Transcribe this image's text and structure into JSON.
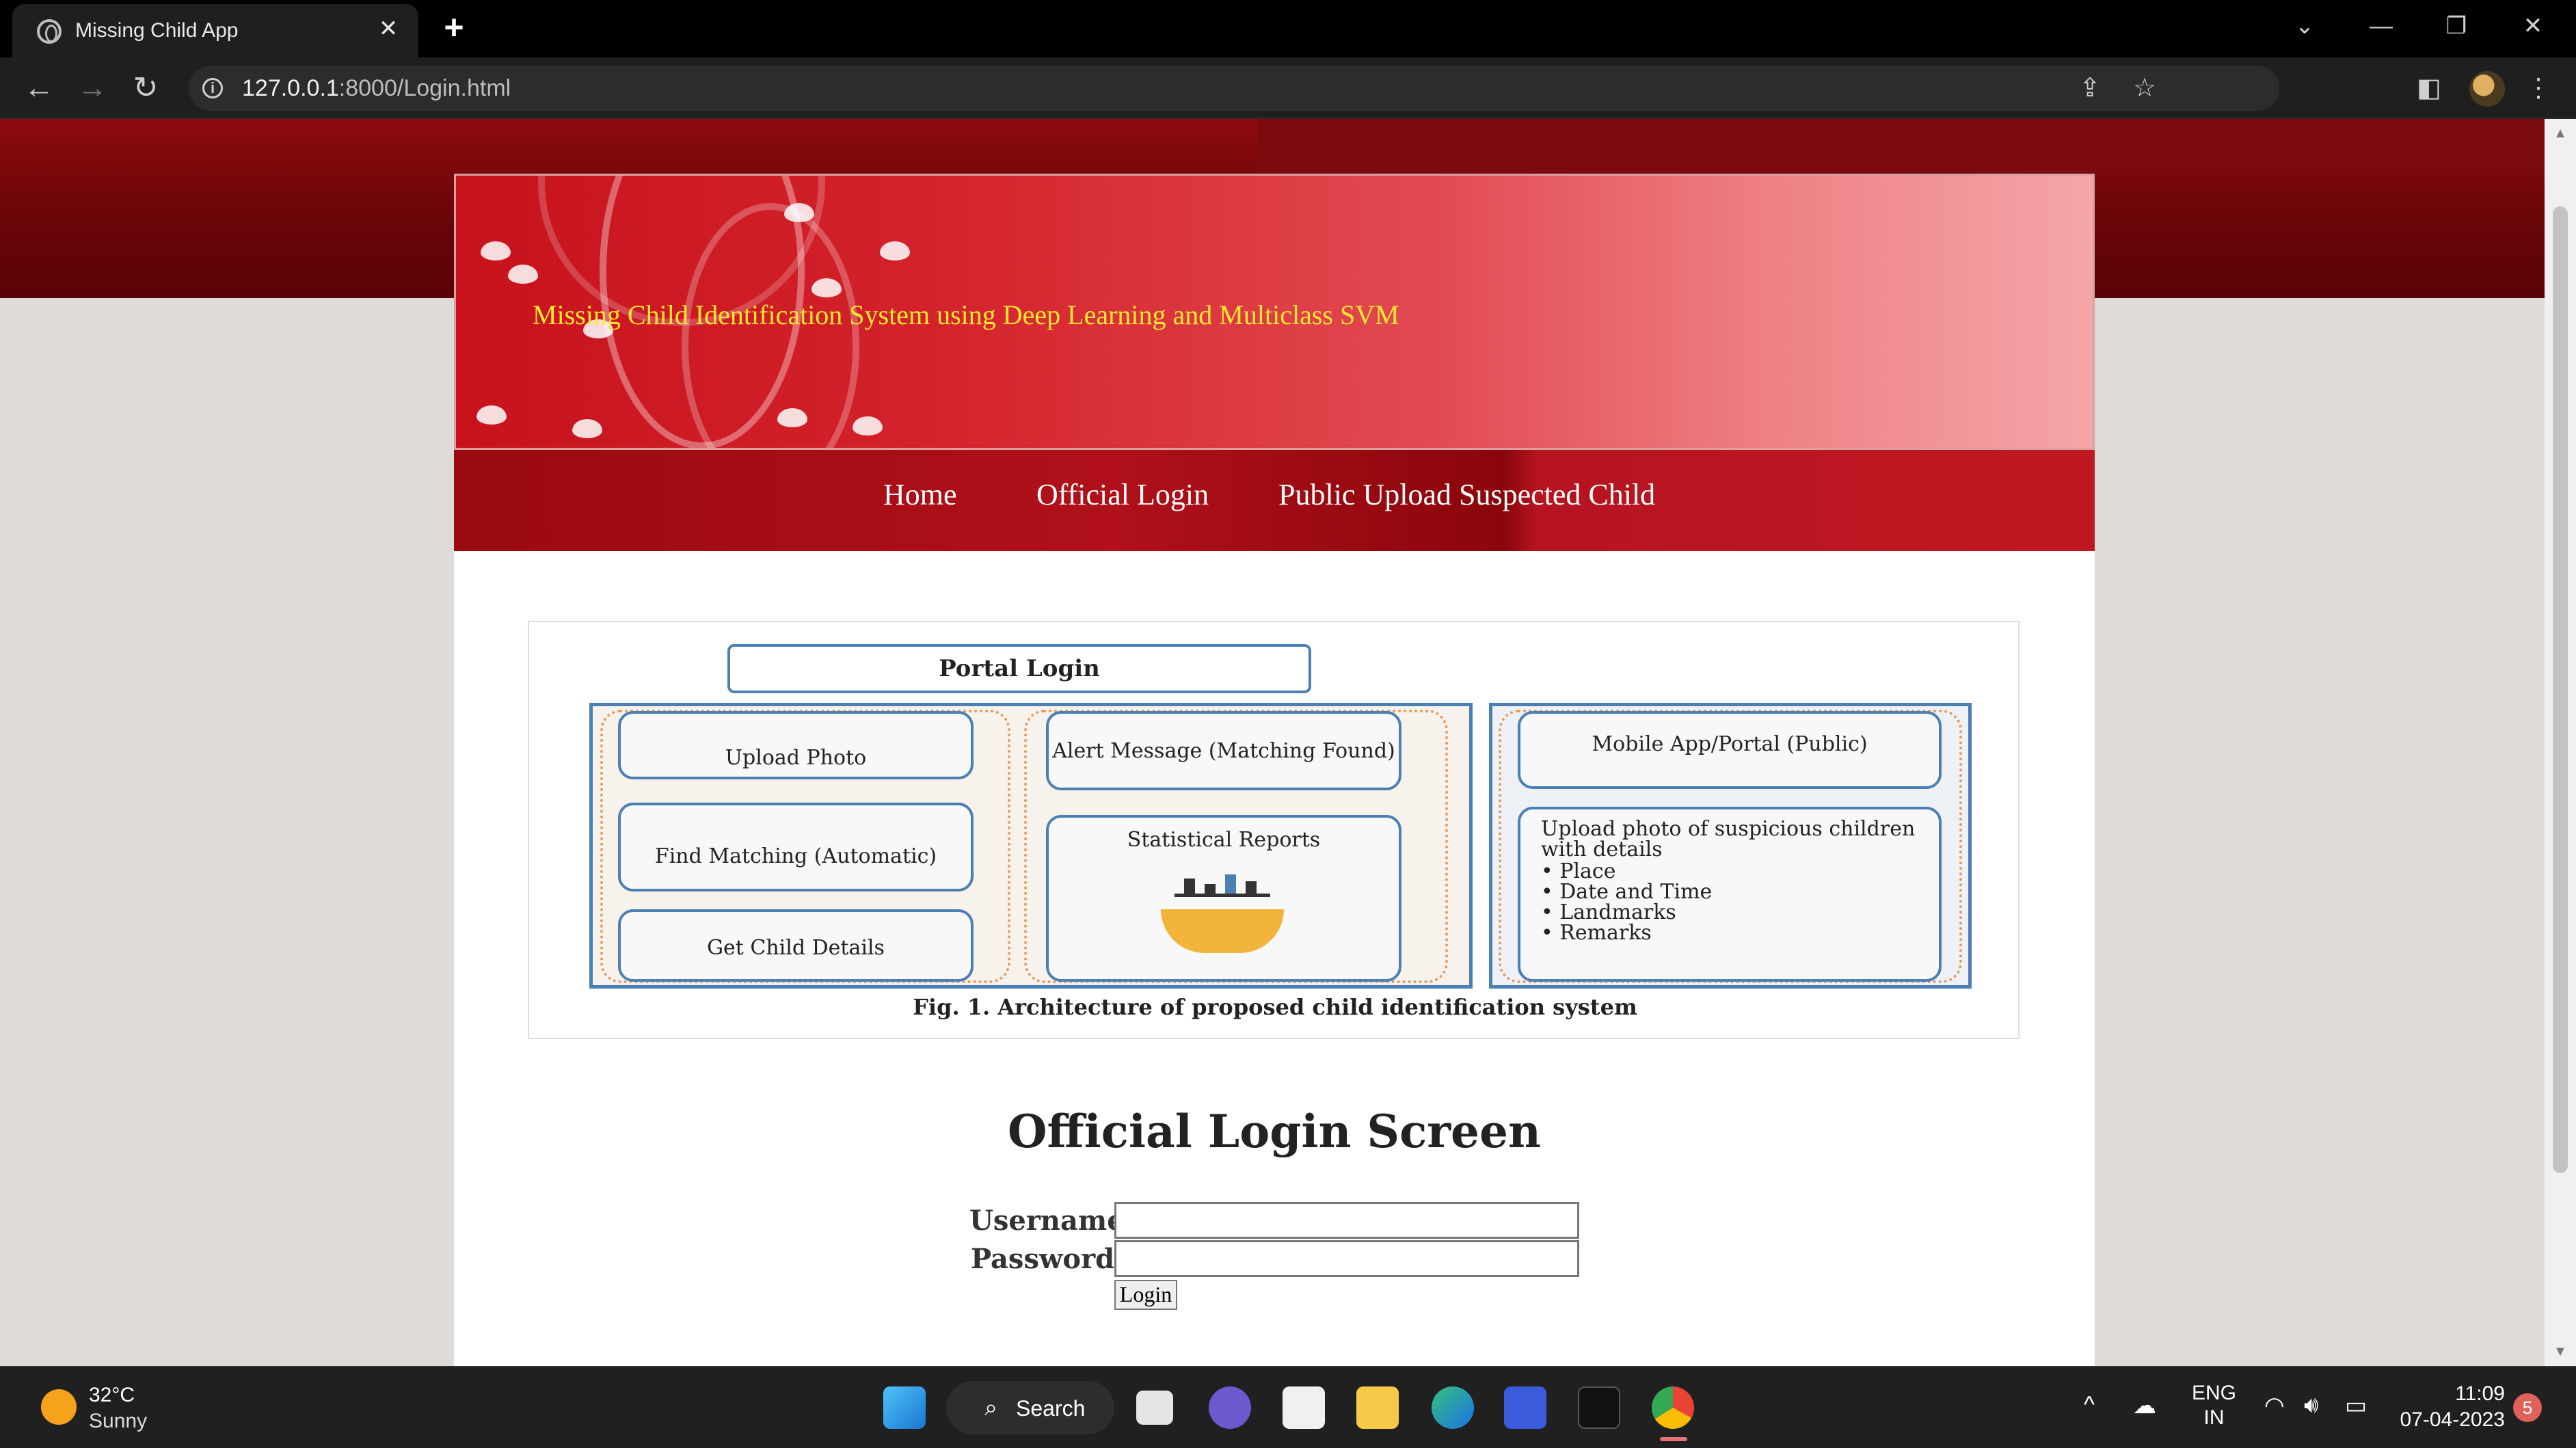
{
  "browser": {
    "tab_title": "Missing Child App",
    "tab_close": "✕",
    "new_tab": "+",
    "url_host": "127.0.0.1",
    "url_rest": ":8000/Login.html",
    "controls": {
      "dropdown": "⌄",
      "minimize": "—",
      "restore": "❐",
      "close": "✕"
    }
  },
  "site": {
    "title": "Missing Child Identification System using Deep Learning and Multiclass SVM",
    "nav": [
      "Home",
      "Official Login",
      "Public Upload Suspected Child"
    ]
  },
  "figure": {
    "portal_login": "Portal Login",
    "col1": [
      "Upload Photo",
      "Find Matching (Automatic)",
      "Get Child Details"
    ],
    "col2": [
      "Alert Message (Matching Found)",
      "Statistical Reports"
    ],
    "col3_title": "Mobile App/Portal (Public)",
    "col3_body": "Upload photo of suspicious children with details",
    "col3_bullets": [
      "Place",
      "Date and Time",
      "Landmarks",
      "Remarks"
    ],
    "caption": "Fig. 1.   Architecture of proposed child identification system"
  },
  "login": {
    "heading": "Official Login Screen",
    "username_label": "Username",
    "password_label": "Password",
    "button_label": "Login"
  },
  "taskbar": {
    "temperature": "32°C",
    "weather": "Sunny",
    "search_label": "Search",
    "lang_top": "ENG",
    "lang_bottom": "IN",
    "time": "11:09",
    "date": "07-04-2023",
    "notification_count": "5"
  },
  "colors": {
    "header_red": "#c7121c",
    "title_yellow": "#ffe830",
    "nav_dark_red": "#9a0a10",
    "page_bg": "#dedbd8"
  }
}
